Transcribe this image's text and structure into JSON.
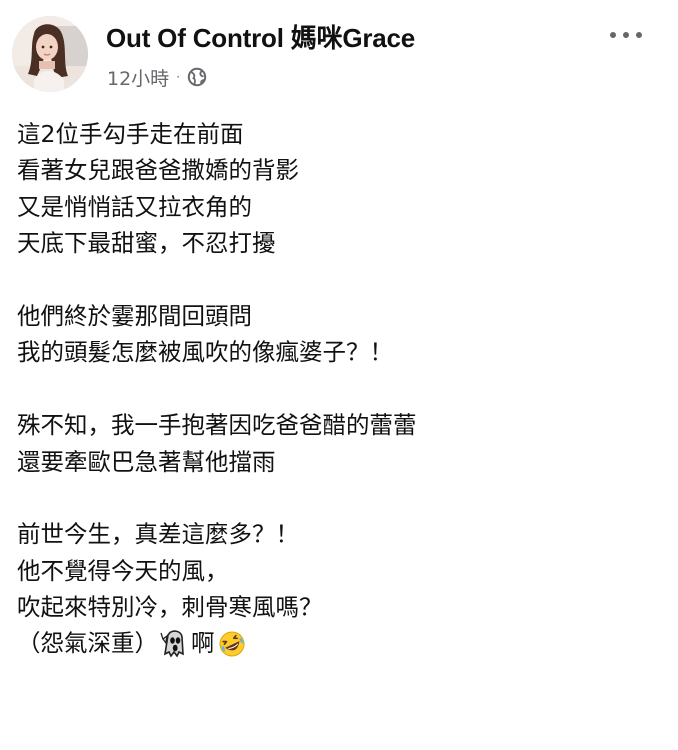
{
  "post": {
    "author": "Out Of Control 媽咪Grace",
    "timestamp": "12小時",
    "separator": "·",
    "privacy_icon": "public-globe-icon",
    "menu_icon": "more-options-icon",
    "lines": [
      "這2位手勾手走在前面",
      "看著女兒跟爸爸撒嬌的背影",
      "又是悄悄話又拉衣角的",
      "天底下最甜蜜，不忍打擾",
      "他們終於霎那間回頭問",
      "我的頭髮怎麼被風吹的像瘋婆子？！",
      "殊不知，我一手抱著因吃爸爸醋的蕾蕾",
      "還要牽歐巴急著幫他擋雨",
      "前世今生，真差這麼多？！",
      "他不覺得今天的風，",
      "吹起來特別冷，刺骨寒風嗎？"
    ],
    "last_line_text": "（怨氣深重）",
    "last_line_tail": "啊",
    "emoji_1": "screaming-ghost-emoji",
    "emoji_2": "rolling-on-floor-laughing-emoji"
  },
  "colors": {
    "text": "#111111",
    "meta": "#65676b",
    "background": "#ffffff"
  }
}
